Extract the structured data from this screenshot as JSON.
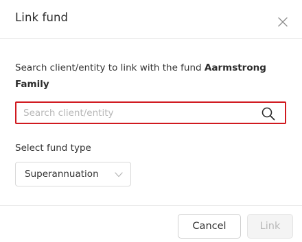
{
  "dialog": {
    "title": "Link fund",
    "close_icon": "close-icon",
    "prompt_text": "Search client/entity to link with the fund",
    "fund_name": "Aarmstrong Family",
    "search": {
      "placeholder": "Search client/entity",
      "value": "",
      "icon": "search-icon",
      "highlight_color": "#d0191f"
    },
    "fund_type": {
      "label": "Select fund type",
      "selected": "Superannuation",
      "icon": "chevron-down-icon"
    },
    "buttons": {
      "cancel_label": "Cancel",
      "link_label": "Link",
      "link_disabled": true
    }
  }
}
